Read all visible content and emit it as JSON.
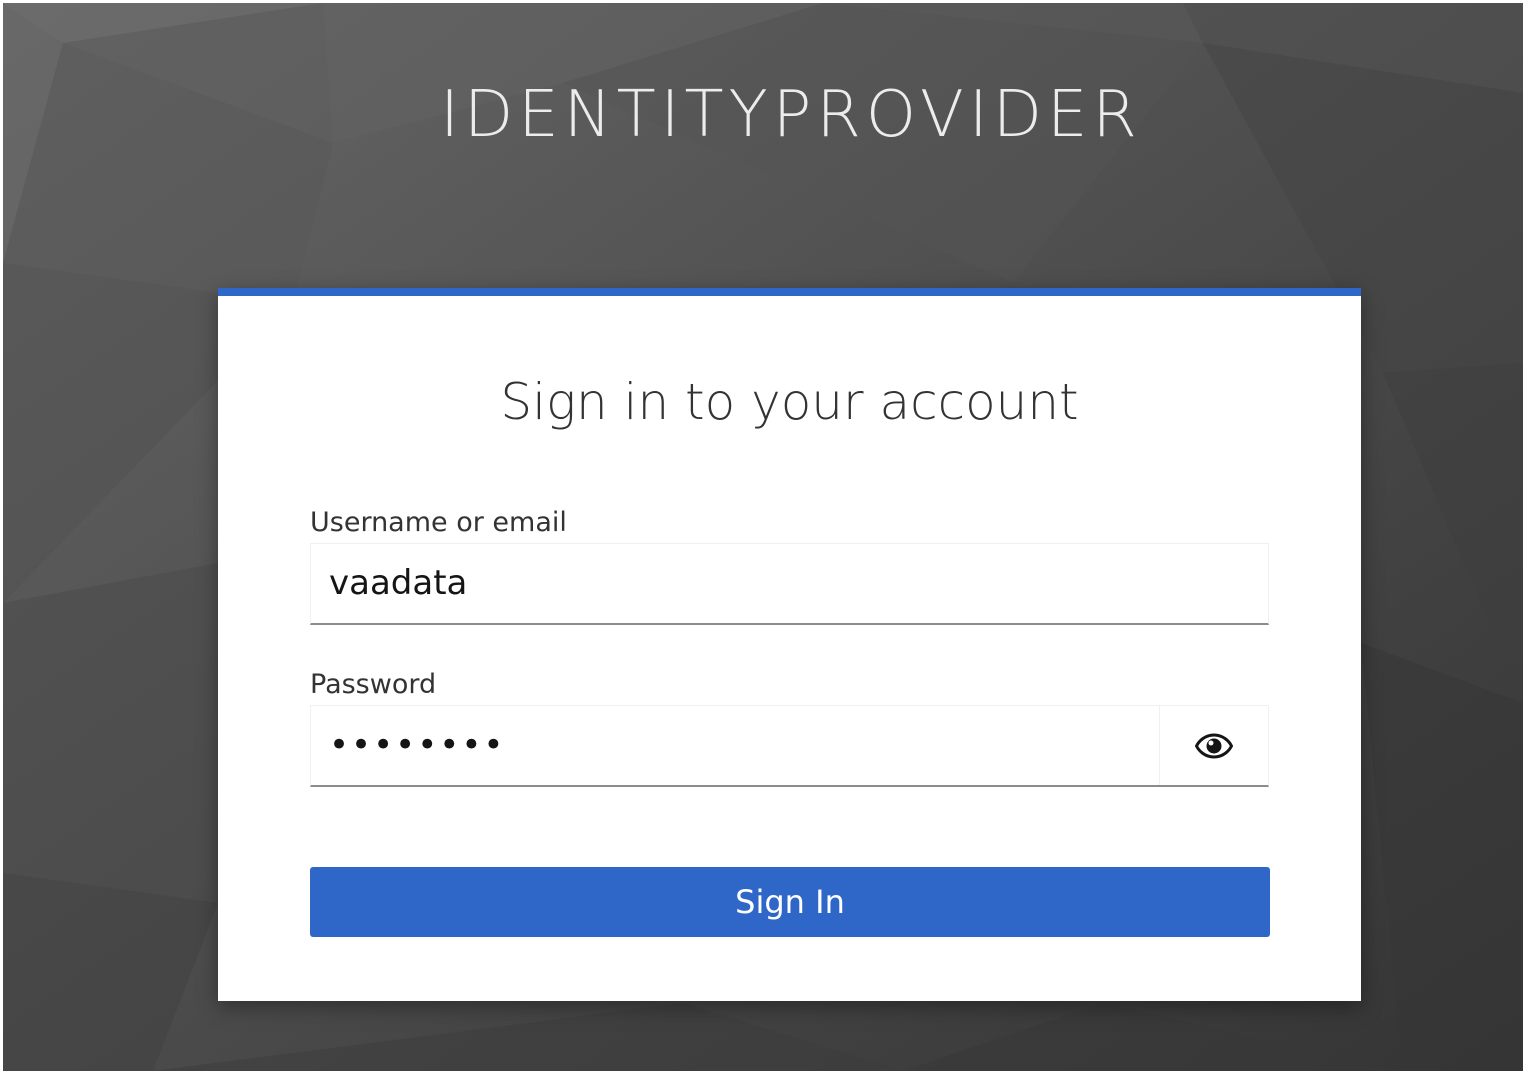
{
  "brand": {
    "title": "IDENTITYPROVIDER"
  },
  "login": {
    "heading": "Sign in to your account",
    "username": {
      "label": "Username or email",
      "value": "vaadata"
    },
    "password": {
      "label": "Password",
      "value": "vaadata1",
      "toggle_icon": "eye-icon"
    },
    "submit_label": "Sign In"
  },
  "colors": {
    "accent": "#2f67c9",
    "background": "#4a4a4a",
    "card": "#ffffff"
  }
}
